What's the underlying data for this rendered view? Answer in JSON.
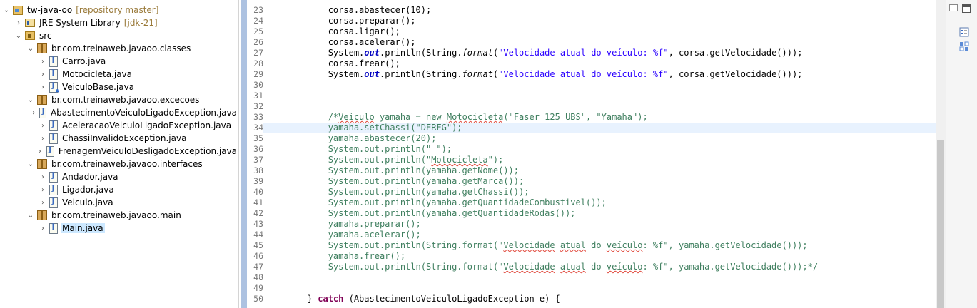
{
  "explorer": {
    "tree": [
      {
        "id": "project",
        "label": "tw-java-oo",
        "decoration": "[repository master]",
        "icon": "project-icon",
        "depth": 0,
        "expanded": true
      },
      {
        "id": "jre",
        "label": "JRE System Library",
        "decoration": "[jdk-21]",
        "icon": "library-icon",
        "depth": 1,
        "expanded": false
      },
      {
        "id": "src",
        "label": "src",
        "decoration": "",
        "icon": "source-folder-icon",
        "depth": 1,
        "expanded": true
      },
      {
        "id": "pkg-classes",
        "label": "br.com.treinaweb.javaoo.classes",
        "decoration": "",
        "icon": "package-icon",
        "depth": 2,
        "expanded": true
      },
      {
        "id": "carro",
        "label": "Carro.java",
        "decoration": "",
        "icon": "java-file-icon",
        "depth": 3,
        "expanded": false
      },
      {
        "id": "motocicleta",
        "label": "Motocicleta.java",
        "decoration": "",
        "icon": "java-file-icon",
        "depth": 3,
        "expanded": false
      },
      {
        "id": "veiculobase",
        "label": "VeiculoBase.java",
        "decoration": "",
        "icon": "java-abstract-file-icon",
        "depth": 3,
        "expanded": false
      },
      {
        "id": "pkg-excecoes",
        "label": "br.com.treinaweb.javaoo.excecoes",
        "decoration": "",
        "icon": "package-icon",
        "depth": 2,
        "expanded": true
      },
      {
        "id": "ex1",
        "label": "AbastecimentoVeiculoLigadoException.java",
        "decoration": "",
        "icon": "java-file-icon",
        "depth": 3,
        "expanded": false
      },
      {
        "id": "ex2",
        "label": "AceleracaoVeiculoLigadoException.java",
        "decoration": "",
        "icon": "java-file-icon",
        "depth": 3,
        "expanded": false
      },
      {
        "id": "ex3",
        "label": "ChassiInvalidoException.java",
        "decoration": "",
        "icon": "java-file-icon",
        "depth": 3,
        "expanded": false
      },
      {
        "id": "ex4",
        "label": "FrenagemVeiculoDesligadoException.java",
        "decoration": "",
        "icon": "java-file-icon",
        "depth": 3,
        "expanded": false
      },
      {
        "id": "pkg-interfaces",
        "label": "br.com.treinaweb.javaoo.interfaces",
        "decoration": "",
        "icon": "package-icon",
        "depth": 2,
        "expanded": true
      },
      {
        "id": "andador",
        "label": "Andador.java",
        "decoration": "",
        "icon": "java-file-icon",
        "depth": 3,
        "expanded": false
      },
      {
        "id": "ligador",
        "label": "Ligador.java",
        "decoration": "",
        "icon": "java-file-icon",
        "depth": 3,
        "expanded": false
      },
      {
        "id": "veiculo",
        "label": "Veiculo.java",
        "decoration": "",
        "icon": "java-file-icon",
        "depth": 3,
        "expanded": false
      },
      {
        "id": "pkg-main",
        "label": "br.com.treinaweb.javaoo.main",
        "decoration": "",
        "icon": "package-icon",
        "depth": 2,
        "expanded": true
      },
      {
        "id": "main",
        "label": "Main.java",
        "decoration": "",
        "icon": "java-file-icon",
        "depth": 3,
        "expanded": false,
        "selected": true
      }
    ]
  },
  "editor": {
    "current_line": 34,
    "lines": [
      {
        "n": "23",
        "html": "            corsa.abastecer(10);"
      },
      {
        "n": "24",
        "html": "            corsa.preparar();"
      },
      {
        "n": "25",
        "html": "            corsa.ligar();"
      },
      {
        "n": "26",
        "html": "            corsa.acelerar();"
      },
      {
        "n": "27",
        "segments": [
          [
            "",
            "            System."
          ],
          [
            "fld",
            "out"
          ],
          [
            "",
            ".println(String."
          ],
          [
            "ital",
            "format"
          ],
          [
            "",
            "("
          ],
          [
            "str",
            "\"Velocidade atual do veículo: %f\""
          ],
          [
            "",
            ", corsa.getVelocidade()));"
          ]
        ]
      },
      {
        "n": "28",
        "html": "            corsa.frear();"
      },
      {
        "n": "29",
        "segments": [
          [
            "",
            "            System."
          ],
          [
            "fld",
            "out"
          ],
          [
            "",
            ".println(String."
          ],
          [
            "ital",
            "format"
          ],
          [
            "",
            "("
          ],
          [
            "str",
            "\"Velocidade atual do veículo: %f\""
          ],
          [
            "",
            ", corsa.getVelocidade()));"
          ]
        ]
      },
      {
        "n": "30",
        "html": ""
      },
      {
        "n": "31",
        "html": ""
      },
      {
        "n": "32",
        "html": ""
      },
      {
        "n": "33",
        "segments": [
          [
            "cmt",
            "            /*"
          ],
          [
            "cmt spell",
            "Veiculo"
          ],
          [
            "cmt",
            " yamaha = new "
          ],
          [
            "cmt spell",
            "Motocicleta"
          ],
          [
            "cmt",
            "(\"Faser 125 UBS\", \"Yamaha\");"
          ]
        ]
      },
      {
        "n": "34",
        "segments": [
          [
            "cmt",
            "            yamaha.setChassi(\"DERFG\");"
          ]
        ]
      },
      {
        "n": "35",
        "segments": [
          [
            "cmt",
            "            yamaha.abastecer(20);"
          ]
        ]
      },
      {
        "n": "36",
        "segments": [
          [
            "cmt",
            "            System.out.println(\" \");"
          ]
        ]
      },
      {
        "n": "37",
        "segments": [
          [
            "cmt",
            "            System.out.println(\""
          ],
          [
            "cmt spell",
            "Motocicleta"
          ],
          [
            "cmt",
            "\");"
          ]
        ]
      },
      {
        "n": "38",
        "segments": [
          [
            "cmt",
            "            System.out.println(yamaha.getNome());"
          ]
        ]
      },
      {
        "n": "39",
        "segments": [
          [
            "cmt",
            "            System.out.println(yamaha.getMarca());"
          ]
        ]
      },
      {
        "n": "40",
        "segments": [
          [
            "cmt",
            "            System.out.println(yamaha.getChassi());"
          ]
        ]
      },
      {
        "n": "41",
        "segments": [
          [
            "cmt",
            "            System.out.println(yamaha.getQuantidadeCombustivel());"
          ]
        ]
      },
      {
        "n": "42",
        "segments": [
          [
            "cmt",
            "            System.out.println(yamaha.getQuantidadeRodas());"
          ]
        ]
      },
      {
        "n": "43",
        "segments": [
          [
            "cmt",
            "            yamaha.preparar();"
          ]
        ]
      },
      {
        "n": "44",
        "segments": [
          [
            "cmt",
            "            yamaha.acelerar();"
          ]
        ]
      },
      {
        "n": "45",
        "segments": [
          [
            "cmt",
            "            System.out.println(String.format(\""
          ],
          [
            "cmt spell",
            "Velocidade"
          ],
          [
            "cmt",
            " "
          ],
          [
            "cmt spell",
            "atual"
          ],
          [
            "cmt",
            " do "
          ],
          [
            "cmt spell",
            "veículo"
          ],
          [
            "cmt",
            ": %f\", yamaha.getVelocidade()));"
          ]
        ]
      },
      {
        "n": "46",
        "segments": [
          [
            "cmt",
            "            yamaha.frear();"
          ]
        ]
      },
      {
        "n": "47",
        "segments": [
          [
            "cmt",
            "            System.out.println(String.format(\""
          ],
          [
            "cmt spell",
            "Velocidade"
          ],
          [
            "cmt",
            " "
          ],
          [
            "cmt spell",
            "atual"
          ],
          [
            "cmt",
            " do "
          ],
          [
            "cmt spell",
            "veículo"
          ],
          [
            "cmt",
            ": %f\", yamaha.getVelocidade()));*/"
          ]
        ]
      },
      {
        "n": "48",
        "html": ""
      },
      {
        "n": "49",
        "html": ""
      },
      {
        "n": "50",
        "segments": [
          [
            "",
            "        } "
          ],
          [
            "kw",
            "catch"
          ],
          [
            "",
            " (AbastecimentoVeiculoLigadoException e) {"
          ]
        ]
      }
    ]
  },
  "colors": {
    "string": "#2a00ff",
    "keyword": "#7f0055",
    "field": "#0000c0",
    "comment": "#3f7f5f",
    "current_line": "#e8f2fe",
    "selection": "#cce8ff"
  }
}
